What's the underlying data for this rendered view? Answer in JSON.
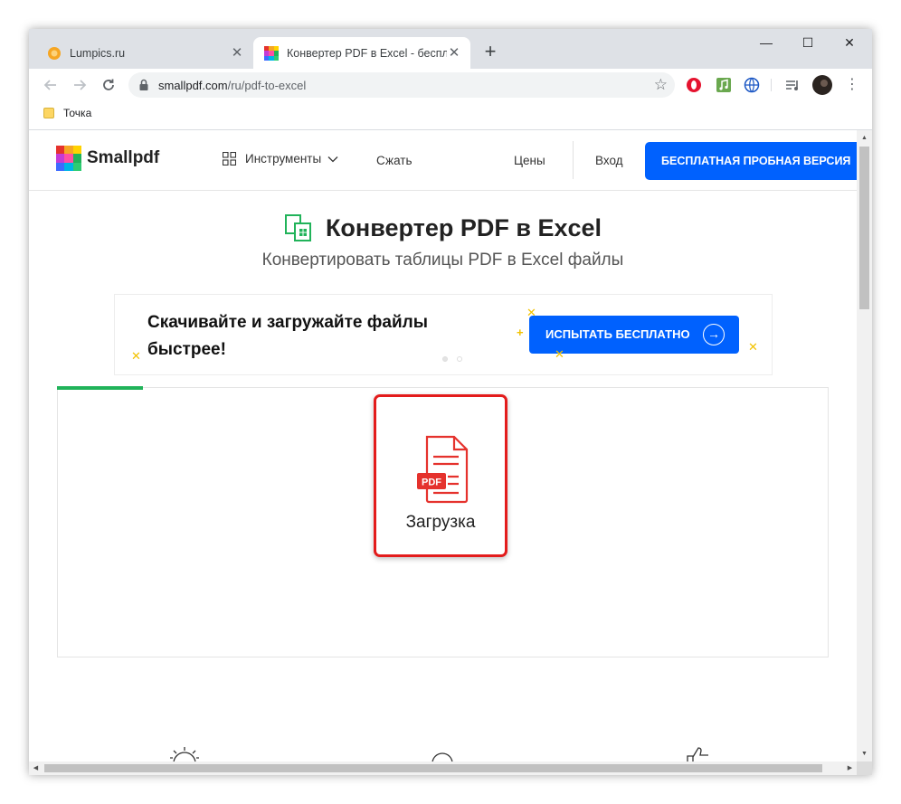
{
  "browser": {
    "tabs": [
      {
        "title": "Lumpics.ru",
        "active": false
      },
      {
        "title": "Конвертер PDF в Excel - бесплат",
        "active": true
      }
    ],
    "new_tab": "+",
    "window_controls": {
      "minimize": "—",
      "maximize": "☐",
      "close": "✕"
    },
    "tab_close": "✕",
    "url": {
      "host": "smallpdf.com",
      "path": "/ru/pdf-to-excel"
    },
    "bookmarks": [
      {
        "label": "Точка"
      }
    ]
  },
  "site": {
    "logo": "Smallpdf",
    "nav": {
      "tools": "Инструменты",
      "compress": "Сжать",
      "prices": "Цены",
      "login": "Вход",
      "trial": "БЕСПЛАТНАЯ ПРОБНАЯ ВЕРСИЯ"
    },
    "title": "Конвертер PDF в Excel",
    "subtitle": "Конвертировать таблицы PDF в Excel файлы",
    "promo": {
      "text": "Скачивайте и загружайте файлы быстрее!",
      "button": "ИСПЫТАТЬ БЕСПЛАТНО",
      "slides": 2,
      "active_slide": 1
    },
    "upload": {
      "label": "Загрузка",
      "badge": "PDF",
      "progress": 0.11
    }
  },
  "colors": {
    "brand_blue": "#0061fe",
    "highlight_red": "#e31c1c",
    "excel_green": "#21b35a",
    "pdf_red": "#e5322d"
  }
}
